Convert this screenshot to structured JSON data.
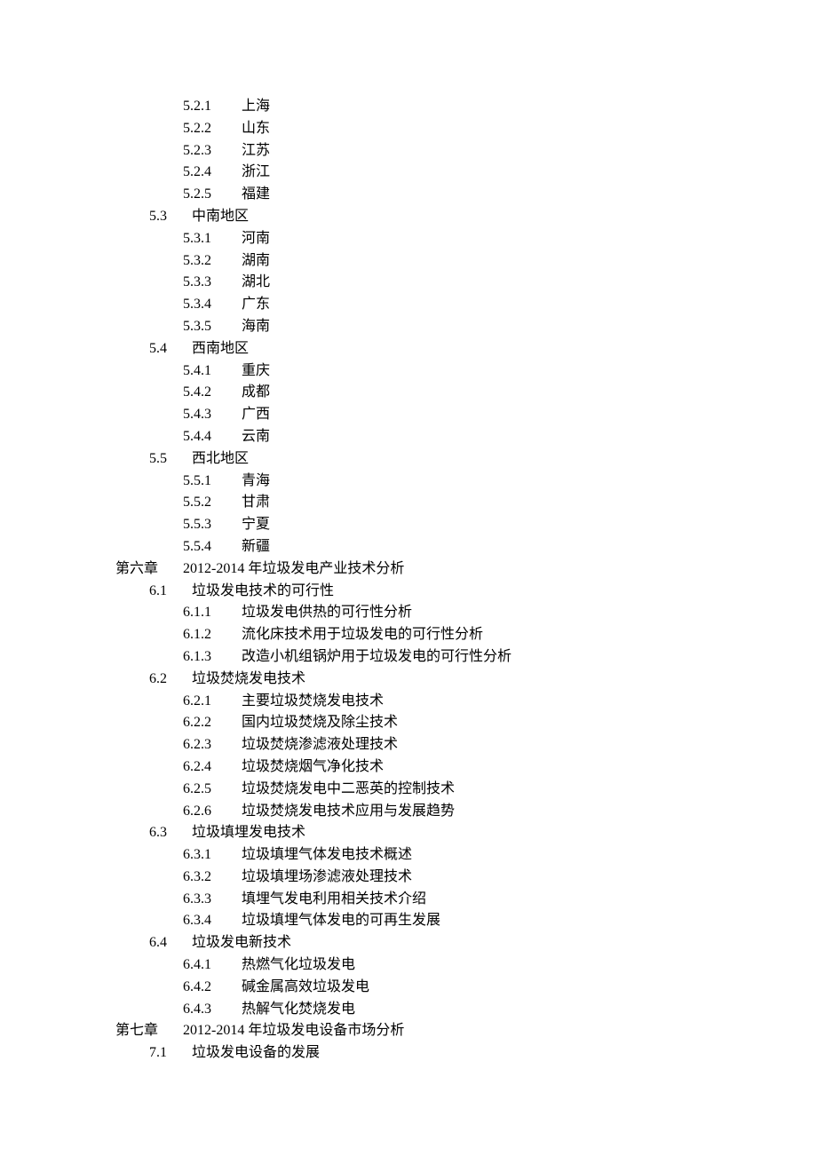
{
  "toc": [
    {
      "level": 3,
      "num": "5.2.1",
      "label": "上海"
    },
    {
      "level": 3,
      "num": "5.2.2",
      "label": "山东"
    },
    {
      "level": 3,
      "num": "5.2.3",
      "label": "江苏"
    },
    {
      "level": 3,
      "num": "5.2.4",
      "label": "浙江"
    },
    {
      "level": 3,
      "num": "5.2.5",
      "label": "福建"
    },
    {
      "level": 2,
      "num": "5.3",
      "label": "中南地区"
    },
    {
      "level": 3,
      "num": "5.3.1",
      "label": "河南"
    },
    {
      "level": 3,
      "num": "5.3.2",
      "label": "湖南"
    },
    {
      "level": 3,
      "num": "5.3.3",
      "label": "湖北"
    },
    {
      "level": 3,
      "num": "5.3.4",
      "label": "广东"
    },
    {
      "level": 3,
      "num": "5.3.5",
      "label": "海南"
    },
    {
      "level": 2,
      "num": "5.4",
      "label": "西南地区"
    },
    {
      "level": 3,
      "num": "5.4.1",
      "label": "重庆"
    },
    {
      "level": 3,
      "num": "5.4.2",
      "label": "成都"
    },
    {
      "level": 3,
      "num": "5.4.3",
      "label": "广西"
    },
    {
      "level": 3,
      "num": "5.4.4",
      "label": "云南"
    },
    {
      "level": 2,
      "num": "5.5",
      "label": "西北地区"
    },
    {
      "level": 3,
      "num": "5.5.1",
      "label": "青海"
    },
    {
      "level": 3,
      "num": "5.5.2",
      "label": "甘肃"
    },
    {
      "level": 3,
      "num": "5.5.3",
      "label": "宁夏"
    },
    {
      "level": 3,
      "num": "5.5.4",
      "label": "新疆"
    },
    {
      "level": 1,
      "num": "第六章",
      "label": "2012-2014 年垃圾发电产业技术分析"
    },
    {
      "level": 2,
      "num": "6.1",
      "label": "垃圾发电技术的可行性"
    },
    {
      "level": 3,
      "num": "6.1.1",
      "label": "垃圾发电供热的可行性分析"
    },
    {
      "level": 3,
      "num": "6.1.2",
      "label": "流化床技术用于垃圾发电的可行性分析"
    },
    {
      "level": 3,
      "num": "6.1.3",
      "label": "改造小机组锅炉用于垃圾发电的可行性分析"
    },
    {
      "level": 2,
      "num": "6.2",
      "label": "垃圾焚烧发电技术"
    },
    {
      "level": 3,
      "num": "6.2.1",
      "label": "主要垃圾焚烧发电技术"
    },
    {
      "level": 3,
      "num": "6.2.2",
      "label": "国内垃圾焚烧及除尘技术"
    },
    {
      "level": 3,
      "num": "6.2.3",
      "label": "垃圾焚烧渗滤液处理技术"
    },
    {
      "level": 3,
      "num": "6.2.4",
      "label": "垃圾焚烧烟气净化技术"
    },
    {
      "level": 3,
      "num": "6.2.5",
      "label": "垃圾焚烧发电中二恶英的控制技术"
    },
    {
      "level": 3,
      "num": "6.2.6",
      "label": "垃圾焚烧发电技术应用与发展趋势"
    },
    {
      "level": 2,
      "num": "6.3",
      "label": "垃圾填埋发电技术"
    },
    {
      "level": 3,
      "num": "6.3.1",
      "label": "垃圾填埋气体发电技术概述"
    },
    {
      "level": 3,
      "num": "6.3.2",
      "label": "垃圾填埋场渗滤液处理技术"
    },
    {
      "level": 3,
      "num": "6.3.3",
      "label": "填埋气发电利用相关技术介绍"
    },
    {
      "level": 3,
      "num": "6.3.4",
      "label": "垃圾填埋气体发电的可再生发展"
    },
    {
      "level": 2,
      "num": "6.4",
      "label": "垃圾发电新技术"
    },
    {
      "level": 3,
      "num": "6.4.1",
      "label": "热燃气化垃圾发电"
    },
    {
      "level": 3,
      "num": "6.4.2",
      "label": "碱金属高效垃圾发电"
    },
    {
      "level": 3,
      "num": "6.4.3",
      "label": "热解气化焚烧发电"
    },
    {
      "level": 1,
      "num": "第七章",
      "label": "2012-2014 年垃圾发电设备市场分析"
    },
    {
      "level": 2,
      "num": "7.1",
      "label": "垃圾发电设备的发展"
    }
  ]
}
